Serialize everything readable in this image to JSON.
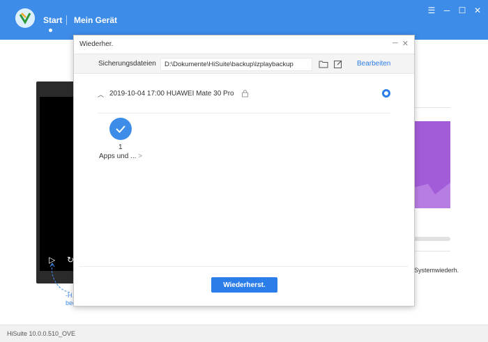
{
  "header": {
    "nav_start": "Start",
    "nav_device": "Mein Gerät",
    "window_controls": [
      "menu-icon",
      "minimize-icon",
      "maximize-icon",
      "close-icon"
    ]
  },
  "background": {
    "hint_text": "-H… e… beginnen",
    "system_restore": "Systemwiederh."
  },
  "dialog": {
    "title": "Wiederher.",
    "toolbar": {
      "label": "Sicherungsdateien",
      "path": "D:\\Dokumente\\HiSuite\\backup\\lzplaybackup",
      "edit_link": "Bearbeiten"
    },
    "entry": {
      "text": "2019-10-04 17:00 HUAWEI Mate 30 Pro",
      "selected": true
    },
    "app_item": {
      "count": "1",
      "label": "Apps und ...",
      "more": ">"
    },
    "restore_button": "Wiederherst."
  },
  "footer": {
    "version": "HiSuite 10.0.0.510_OVE"
  },
  "colors": {
    "header_blue": "#3d8ce8",
    "accent_blue": "#2b7de9",
    "purple_card": "#a35cd8"
  }
}
